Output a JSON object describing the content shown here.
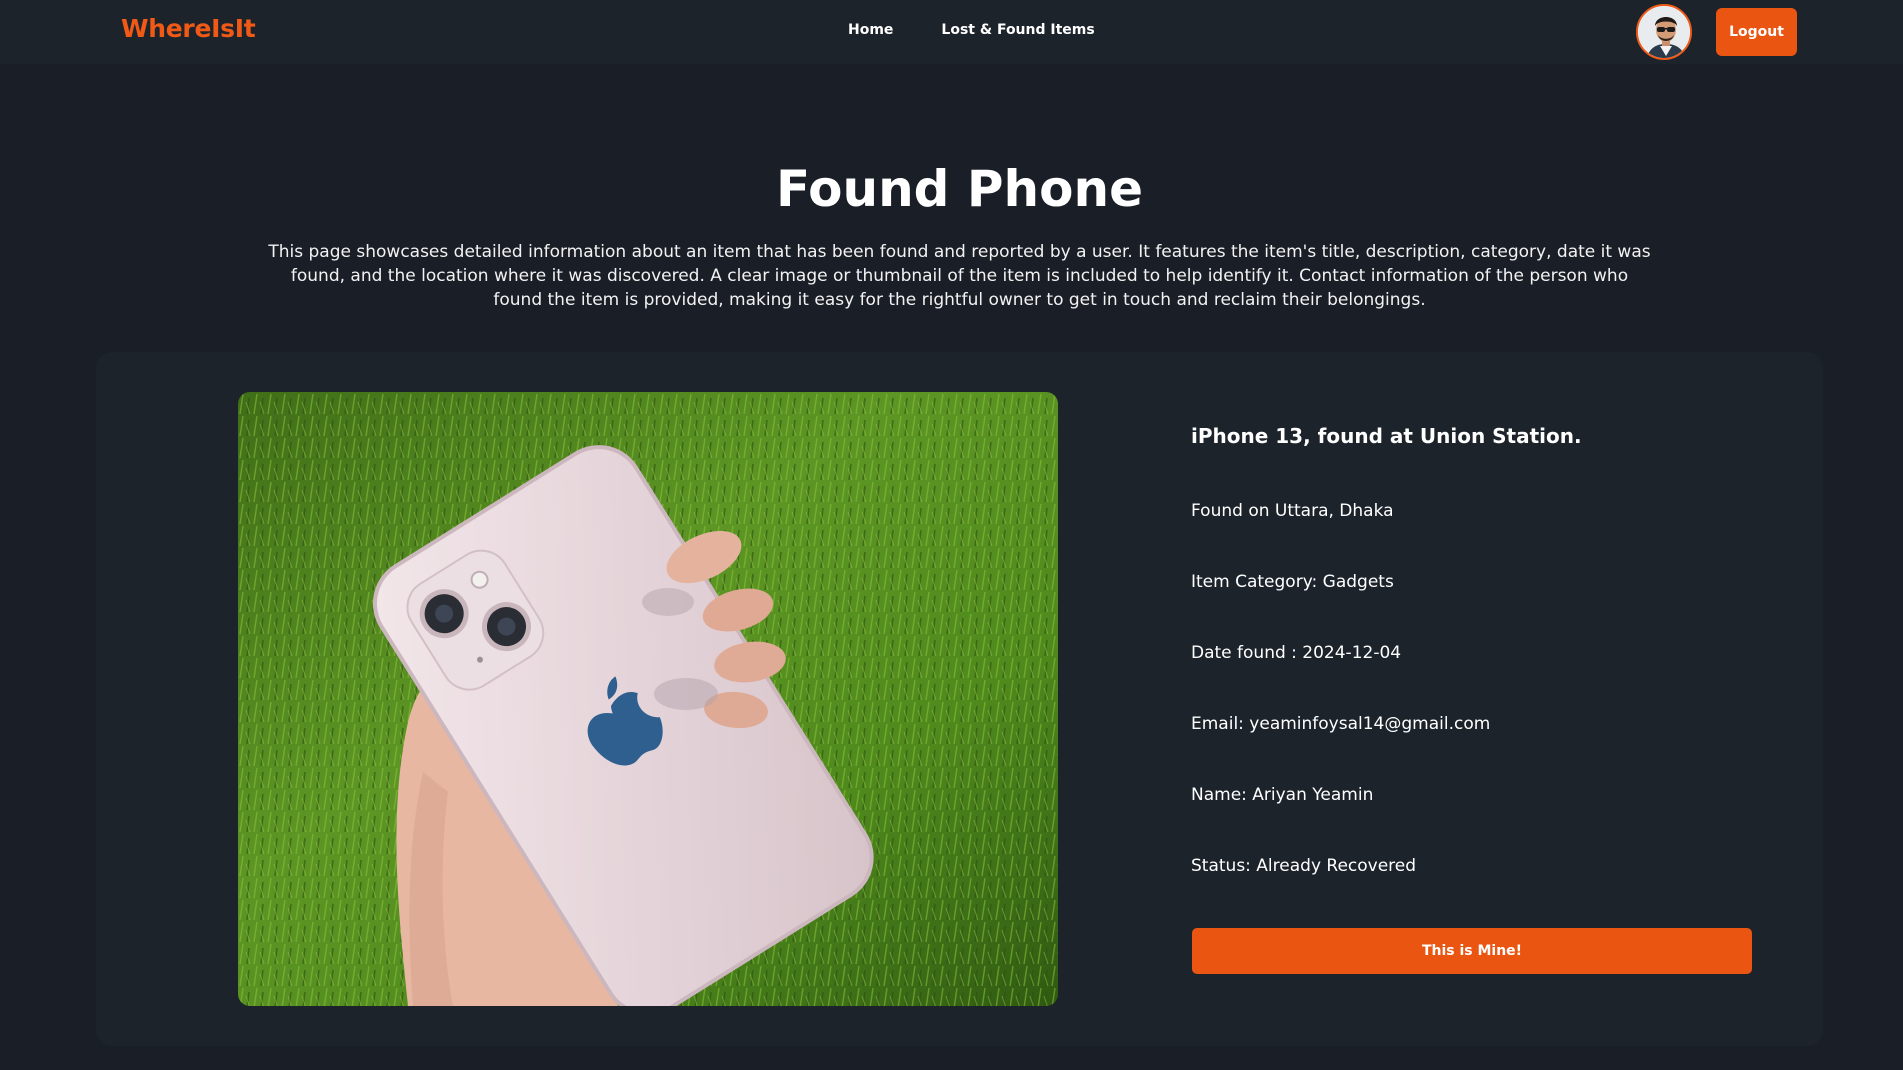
{
  "navbar": {
    "brand": "WhereIsIt",
    "links": [
      {
        "label": "Home"
      },
      {
        "label": "Lost & Found Items"
      }
    ],
    "logout_label": "Logout",
    "accent_color": "#f05a16"
  },
  "header": {
    "title": "Found Phone",
    "description": "This page showcases detailed information about an item that has been found and reported by a user. It features the item's title, description, category, date it was found, and the location where it was discovered. A clear image or thumbnail of the item is included to help identify it. Contact information of the person who found the item is provided, making it easy for the rightful owner to get in touch and reclaim their belongings."
  },
  "item": {
    "title": "iPhone 13, found at Union Station.",
    "location": "Found on Uttara, Dhaka",
    "category": "Item Category: Gadgets",
    "date": "Date found : 2024-12-04",
    "email": "Email: yeaminfoysal14@gmail.com",
    "name": "Name: Ariyan Yeamin",
    "status": "Status: Already Recovered",
    "claim_label": "This is Mine!"
  }
}
